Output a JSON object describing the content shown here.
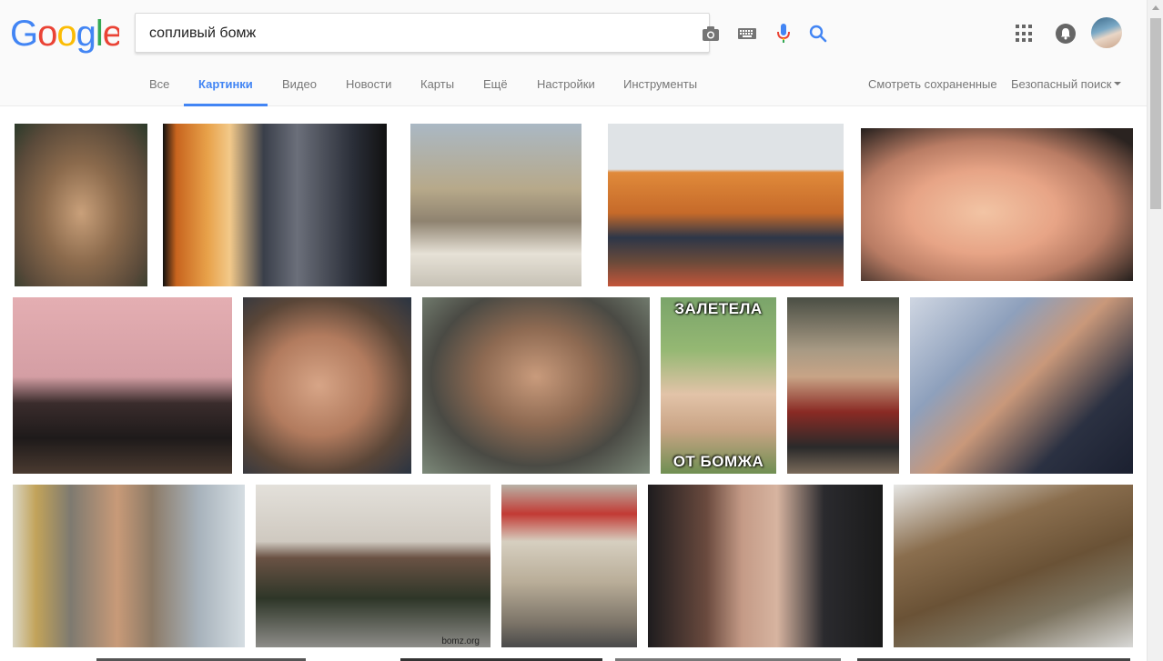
{
  "search": {
    "query": "сопливый бомж"
  },
  "tabs": [
    {
      "label": "Все",
      "active": false
    },
    {
      "label": "Картинки",
      "active": true
    },
    {
      "label": "Видео",
      "active": false
    },
    {
      "label": "Новости",
      "active": false
    },
    {
      "label": "Карты",
      "active": false
    },
    {
      "label": "Ещё",
      "active": false
    },
    {
      "label": "Настройки",
      "active": false
    },
    {
      "label": "Инструменты",
      "active": false
    }
  ],
  "right_links": {
    "saved": "Смотреть сохраненные",
    "safe_search": "Безопасный поиск"
  },
  "colors": {
    "accent": "#4285f4",
    "logo_blue": "#4285f4",
    "logo_red": "#ea4335",
    "logo_yellow": "#fbbc05",
    "logo_green": "#34a853"
  },
  "icons": {
    "camera": "camera-icon",
    "keyboard": "keyboard-icon",
    "mic": "microphone-icon",
    "search": "search-icon",
    "apps": "apps-grid-icon",
    "notifications": "bell-icon"
  },
  "image_captions": {
    "meme_top": "ЗАЛЕТЕЛА",
    "meme_bottom": "ОТ БОМЖА",
    "watermark": "bomz.org"
  }
}
